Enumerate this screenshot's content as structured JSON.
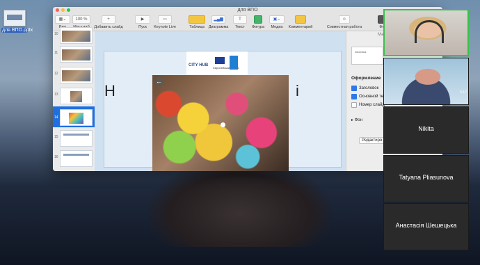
{
  "desktop": {
    "file_name": "для ВПО.pptx"
  },
  "window": {
    "title": "для ВПО",
    "toolbar": {
      "view": "Вид",
      "zoom": "100 %",
      "zoom_label": "Масштаб",
      "add_slide": "Добавить слайд",
      "play": "Пуск",
      "keynote_live": "Keynote Live",
      "table": "Таблица",
      "chart": "Диаграмма",
      "text": "Текст",
      "shape": "Фигура",
      "media": "Медиа",
      "comment": "Комментарий",
      "collaborate": "Совместная работа",
      "format_partial": "Фо"
    }
  },
  "navigator": {
    "slides": [
      {
        "num": "10"
      },
      {
        "num": "11"
      },
      {
        "num": "12"
      },
      {
        "num": "13"
      },
      {
        "num": "14",
        "selected": true
      },
      {
        "num": "15"
      },
      {
        "num": "16"
      }
    ]
  },
  "slide": {
    "logo": {
      "cityhub": "CITY HUB",
      "eu_text": "Європейський Союз"
    },
    "title_left": "Н",
    "title_right": "і"
  },
  "inspector": {
    "tab_partial": "Ма",
    "layout_thumb_text": "Заголовок",
    "section_title": "Оформление",
    "checks": [
      {
        "label": "Заголовок",
        "checked": true
      },
      {
        "label": "Основной те",
        "checked": true
      },
      {
        "label": "Номер слайд",
        "checked": false
      }
    ],
    "background": "Фон",
    "edit_button": "Редактиро"
  },
  "photo_viewer": {
    "back_icon": "arrow-left-icon"
  },
  "video_call": {
    "participants": [
      {
        "name": "",
        "video": true
      },
      {
        "name": "",
        "video": true,
        "timestamp": "5:17"
      },
      {
        "name": "Nikita",
        "video": false
      },
      {
        "name": "Tatyana Pliasunova",
        "video": false
      },
      {
        "name": "Анастасія Шешецька",
        "video": false
      }
    ],
    "active_color": "#39c24a"
  }
}
